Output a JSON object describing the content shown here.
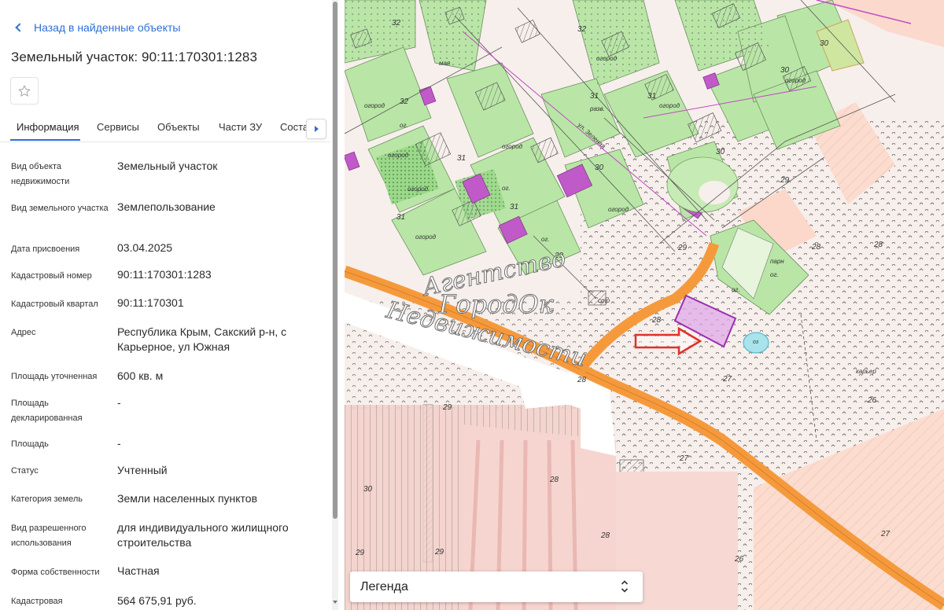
{
  "back_link": "Назад в найденные объекты",
  "title": "Земельный участок: 90:11:170301:1283",
  "tabs": [
    "Информация",
    "Сервисы",
    "Объекты",
    "Части ЗУ",
    "Соста"
  ],
  "active_tab": "Информация",
  "rows": [
    {
      "label": "Вид объекта недвижимости",
      "value": "Земельный участок"
    },
    {
      "label": "Вид земельного участка",
      "value": "Землепользование"
    },
    {
      "label": "Дата присвоения",
      "value": "03.04.2025"
    },
    {
      "label": "Кадастровый номер",
      "value": "90:11:170301:1283"
    },
    {
      "label": "Кадастровый квартал",
      "value": "90:11:170301"
    },
    {
      "label": "Адрес",
      "value": "Республика Крым, Сакский р-н, с Карьерное, ул Южная"
    },
    {
      "label": "Площадь уточненная",
      "value": "600 кв. м"
    },
    {
      "label": "Площадь декларированная",
      "value": "-"
    },
    {
      "label": "Площадь",
      "value": "-"
    },
    {
      "label": "Статус",
      "value": "Учтенный"
    },
    {
      "label": "Категория земель",
      "value": "Земли населенных пунктов"
    },
    {
      "label": "Вид разрешенного использования",
      "value": "для индивидуального жилищного строительства"
    },
    {
      "label": "Форма собственности",
      "value": "Частная"
    },
    {
      "label": "Кадастровая",
      "value": "564 675,91 руб."
    }
  ],
  "map": {
    "watermark": [
      "Агентство",
      "ГородОк",
      "Недвижимости"
    ],
    "labels": [
      "огород",
      "огород",
      "огород",
      "огород",
      "огород",
      "огород",
      "огород",
      "огород",
      "огород",
      "ог.",
      "ог.",
      "ог.",
      "ог.",
      "ог.",
      "стр",
      "разв.",
      "ул. Зеленая",
      "парн",
      "оз",
      "карьер",
      "мая"
    ],
    "numbers": [
      "32",
      "32",
      "32",
      "31",
      "31",
      "31",
      "31",
      "31",
      "30",
      "30",
      "30",
      "30",
      "29",
      "29",
      "29",
      "29",
      "29",
      "28",
      "28",
      "28",
      "28",
      "28",
      "28",
      "27",
      "27",
      "26",
      "26",
      "30",
      "29",
      "27"
    ],
    "legend": "Легенда"
  },
  "colors": {
    "accent": "#2f6fd6",
    "garden": "#b9e6a6",
    "road": "#f59a3c",
    "selected_parcel": "#9b2fb0",
    "arrow": "#e0302a"
  }
}
